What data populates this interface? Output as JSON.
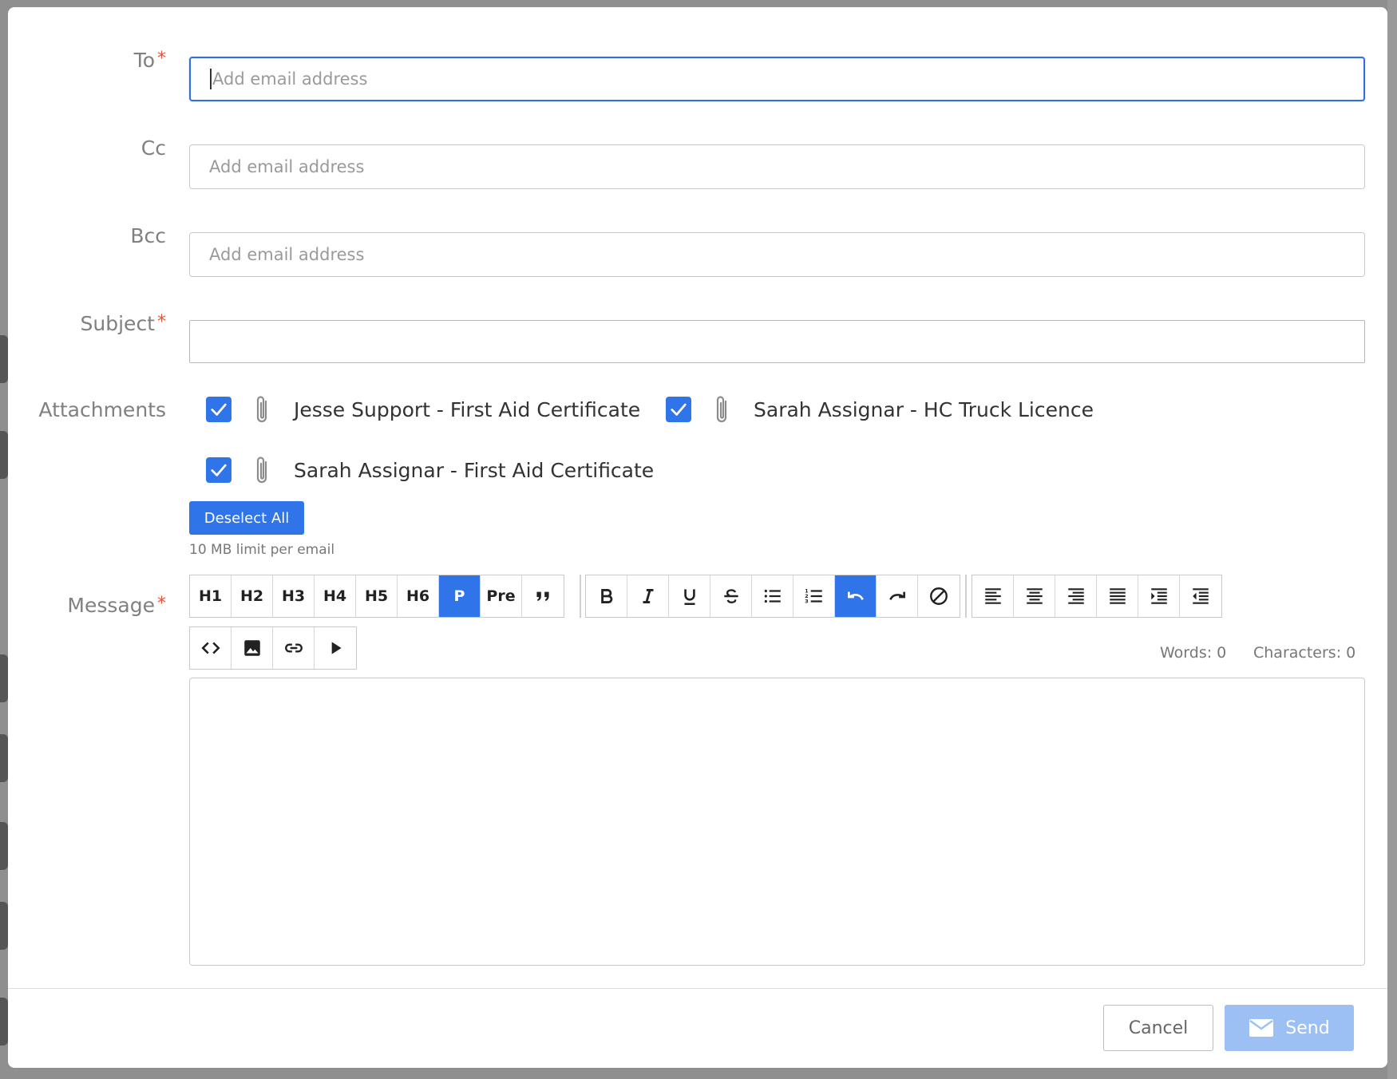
{
  "form": {
    "to": {
      "label": "To",
      "required_mark": "*",
      "placeholder": "Add email address"
    },
    "cc": {
      "label": "Cc",
      "placeholder": "Add email address"
    },
    "bcc": {
      "label": "Bcc",
      "placeholder": "Add email address"
    },
    "subject": {
      "label": "Subject",
      "required_mark": "*",
      "value": ""
    },
    "attachments": {
      "label": "Attachments",
      "items": [
        {
          "name": "Jesse Support - First Aid Certificate",
          "checked": true
        },
        {
          "name": "Sarah Assignar - HC Truck Licence",
          "checked": true
        },
        {
          "name": "Sarah Assignar - First Aid Certificate",
          "checked": true
        }
      ],
      "deselect_label": "Deselect All",
      "limit_text": "10 MB limit per email"
    },
    "message": {
      "label": "Message",
      "required_mark": "*",
      "heading_buttons": [
        "H1",
        "H2",
        "H3",
        "H4",
        "H5",
        "H6",
        "P",
        "Pre"
      ],
      "active_format": "P",
      "words_label": "Words: 0",
      "characters_label": "Characters: 0",
      "body": ""
    }
  },
  "footer": {
    "cancel_label": "Cancel",
    "send_label": "Send"
  },
  "colors": {
    "accent": "#2f74e8",
    "required": "#e5533d",
    "send_disabled": "#9cc0f3"
  },
  "icons": [
    "paperclip-icon",
    "check-icon",
    "quote-icon",
    "bold-icon",
    "italic-icon",
    "underline-icon",
    "strikethrough-icon",
    "bullet-list-icon",
    "numbered-list-icon",
    "undo-icon",
    "redo-icon",
    "clear-format-icon",
    "align-left-icon",
    "align-center-icon",
    "align-right-icon",
    "align-justify-icon",
    "indent-icon",
    "outdent-icon",
    "code-icon",
    "image-icon",
    "link-icon",
    "video-icon",
    "mail-icon"
  ]
}
